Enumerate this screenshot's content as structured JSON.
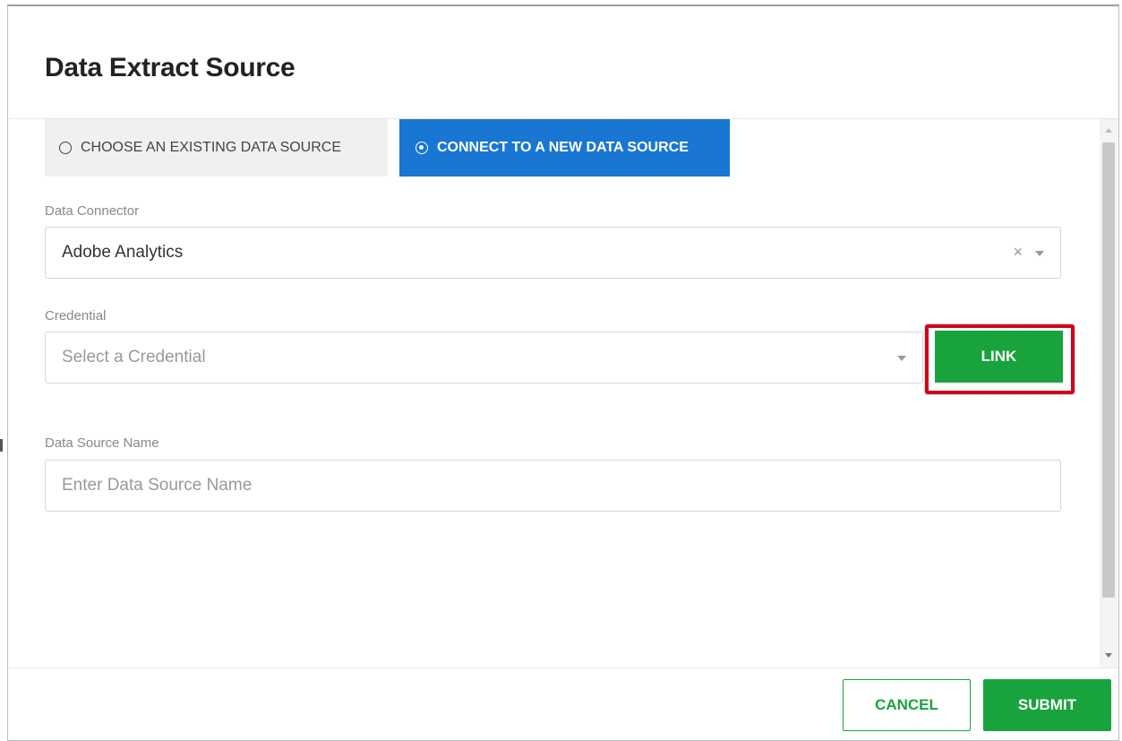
{
  "dialog": {
    "title": "Data Extract Source"
  },
  "tabs": [
    {
      "label": "CHOOSE AN EXISTING DATA SOURCE",
      "selected": false
    },
    {
      "label": "CONNECT TO A NEW DATA SOURCE",
      "selected": true
    }
  ],
  "form": {
    "connector": {
      "label": "Data Connector",
      "value": "Adobe Analytics",
      "clear_icon": "×"
    },
    "credential": {
      "label": "Credential",
      "placeholder": "Select a Credential",
      "link_label": "LINK"
    },
    "source_name": {
      "label": "Data Source Name",
      "placeholder": "Enter Data Source Name",
      "value": ""
    }
  },
  "footer": {
    "cancel_label": "CANCEL",
    "submit_label": "SUBMIT"
  },
  "colors": {
    "primary_blue": "#1976d2",
    "action_green": "#19a33d",
    "highlight_red": "#d0021b"
  },
  "icons": [
    "radio-unchecked-icon",
    "radio-checked-icon",
    "clear-icon",
    "chevron-down-icon",
    "scroll-up-icon",
    "scroll-down-icon"
  ]
}
